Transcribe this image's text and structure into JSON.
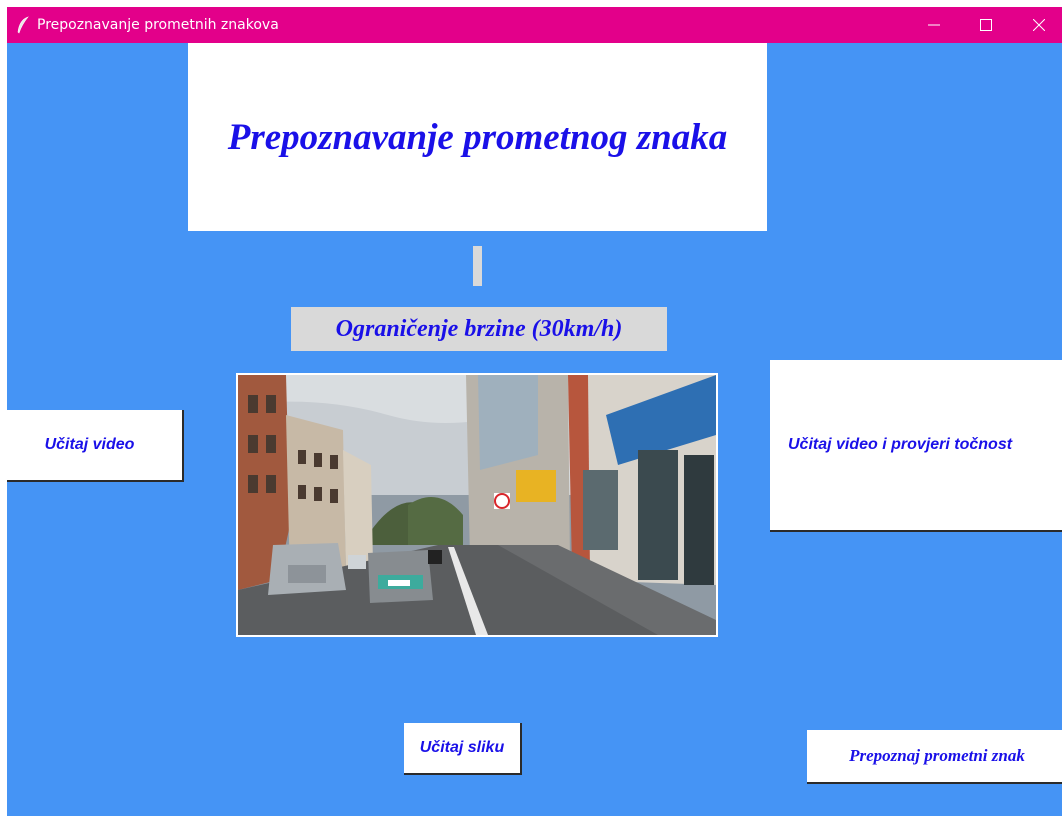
{
  "window": {
    "title": "Prepoznavanje prometnih znakova",
    "titlebar_color": "#e3008a",
    "background_color": "#4594f5",
    "app_icon": "feather-icon",
    "controls": [
      "minimize-icon",
      "maximize-icon",
      "close-icon"
    ]
  },
  "main": {
    "heading": "Prepoznavanje prometnog znaka",
    "result": "Ograničenje brzine (30km/h)",
    "text_color": "#1a10e8",
    "preview": "street-scene-image"
  },
  "buttons": {
    "load_video": "Učitaj video",
    "load_video_check": "Učitaj video i provjeri točnost",
    "load_image": "Učitaj sliku",
    "recognize": "Prepoznaj prometni znak"
  }
}
